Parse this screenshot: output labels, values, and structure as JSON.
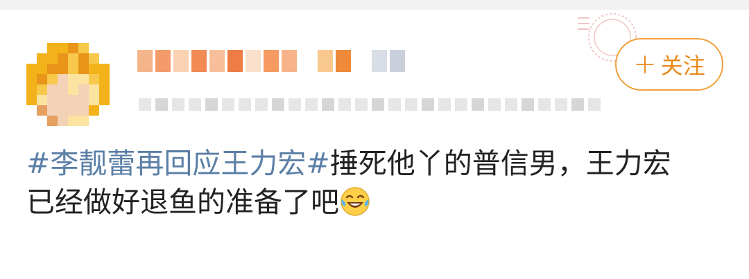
{
  "follow_button": {
    "plus": "+",
    "label": "关注"
  },
  "post": {
    "hashtag": "#李靓蕾再回应王力宏#",
    "line1_rest": "捶死他丫的普信男，王力宏",
    "line2": "已经做好退鱼的准备了吧",
    "emoji": "laughing-tears-emoji"
  },
  "colors": {
    "accent": "#eb8a1a",
    "button_border": "#f0a03c",
    "hashtag": "#5b7fa6",
    "text": "#222222"
  }
}
